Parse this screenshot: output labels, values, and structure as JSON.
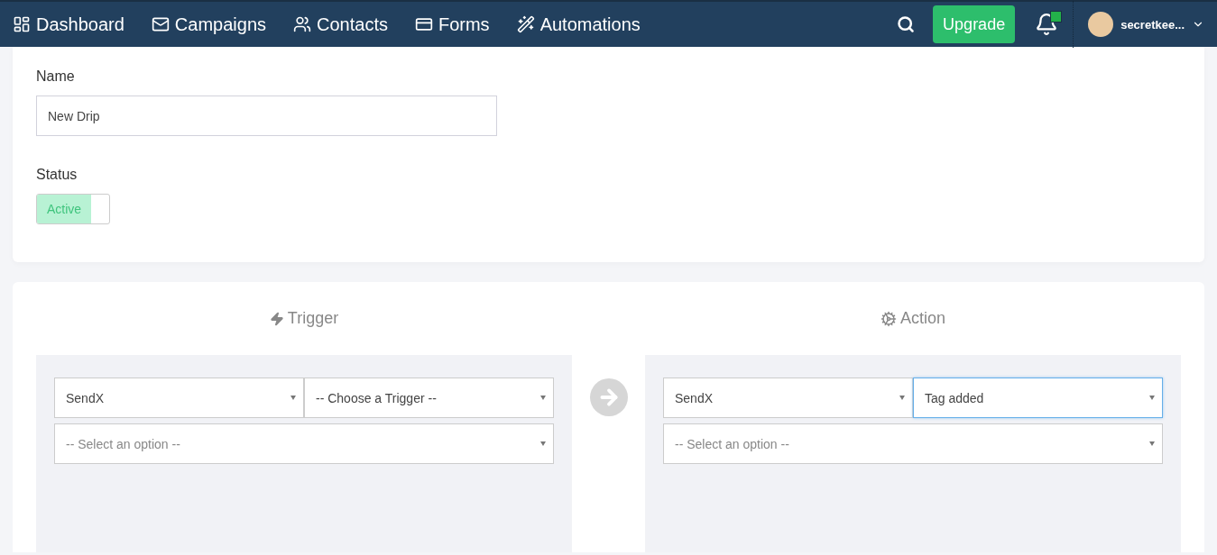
{
  "nav": {
    "items": [
      {
        "label": "Dashboard"
      },
      {
        "label": "Campaigns"
      },
      {
        "label": "Contacts"
      },
      {
        "label": "Forms"
      },
      {
        "label": "Automations"
      }
    ],
    "upgrade": "Upgrade",
    "notifications_checked": true,
    "user": "secretkee..."
  },
  "form": {
    "name_label": "Name",
    "name_value": "New Drip",
    "status_label": "Status",
    "status": {
      "label": "Active",
      "on": true
    }
  },
  "trigger": {
    "title": "Trigger",
    "selects": [
      {
        "value": "SendX",
        "focused": false
      },
      {
        "value": "-- Choose a Trigger --",
        "focused": false
      },
      {
        "placeholder": "-- Select an option --",
        "focused": false
      }
    ]
  },
  "action": {
    "title": "Action",
    "selects": [
      {
        "value": "SendX",
        "focused": false
      },
      {
        "value": "Tag added",
        "focused": true
      },
      {
        "placeholder": "-- Select an option --",
        "focused": false
      }
    ]
  }
}
